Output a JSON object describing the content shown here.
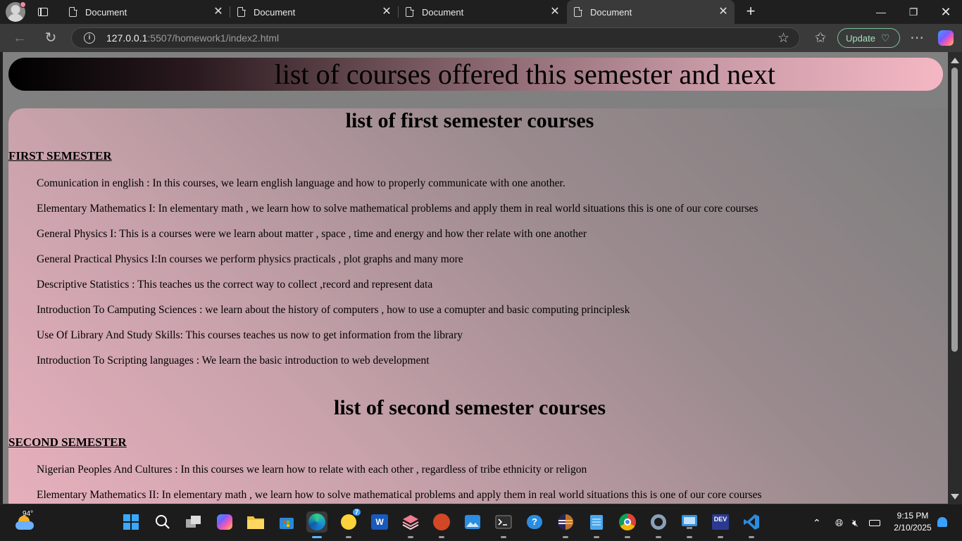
{
  "browser": {
    "tabs": [
      {
        "title": "Document",
        "active": false
      },
      {
        "title": "Document",
        "active": false
      },
      {
        "title": "Document",
        "active": false
      },
      {
        "title": "Document",
        "active": true
      }
    ],
    "url_host": "127.0.0.1",
    "url_rest": ":5507/homework1/index2.html",
    "update_label": "Update"
  },
  "page": {
    "banner": "list of courses offered this semester and next",
    "first_heading": "list of first semester courses",
    "first_label": "FIRST SEMESTER",
    "first_courses": [
      "Comunication in english : In this courses, we learn english language and how to properly communicate with one another.",
      "Elementary Mathematics I: In elementary math , we learn how to solve mathematical problems and apply them in real world situations this is one of our core courses",
      "General Physics I: This is a courses were we learn about matter , space , time and energy and how ther relate with one another",
      "General Practical Physics I:In courses we perform physics practicals , plot graphs and many more",
      "Descriptive Statistics : This teaches us the correct way to collect ,record and represent data",
      "Introduction To Camputing Sciences : we learn about the history of computers , how to use a comupter and basic computing principlesk",
      "Use Of Library And Study Skills: This courses teaches us now to get information from the library",
      "Introduction To Scripting languages : We learn the basic introduction to web development"
    ],
    "second_heading": "list of second semester courses",
    "second_label": "SECOND SEMESTER",
    "second_courses": [
      "Nigerian Peoples And Cultures : In this courses we learn how to relate with each other , regardless of tribe ethnicity or religon",
      "Elementary Mathematics II: In elementary math , we learn how to solve mathematical problems and apply them in real world situations this is one of our core courses"
    ]
  },
  "taskbar": {
    "weather_temp": "94°",
    "chat_badge": "7",
    "word_label": "W",
    "dev_label": "DEV",
    "time": "9:15 PM",
    "date": "2/10/2025"
  }
}
